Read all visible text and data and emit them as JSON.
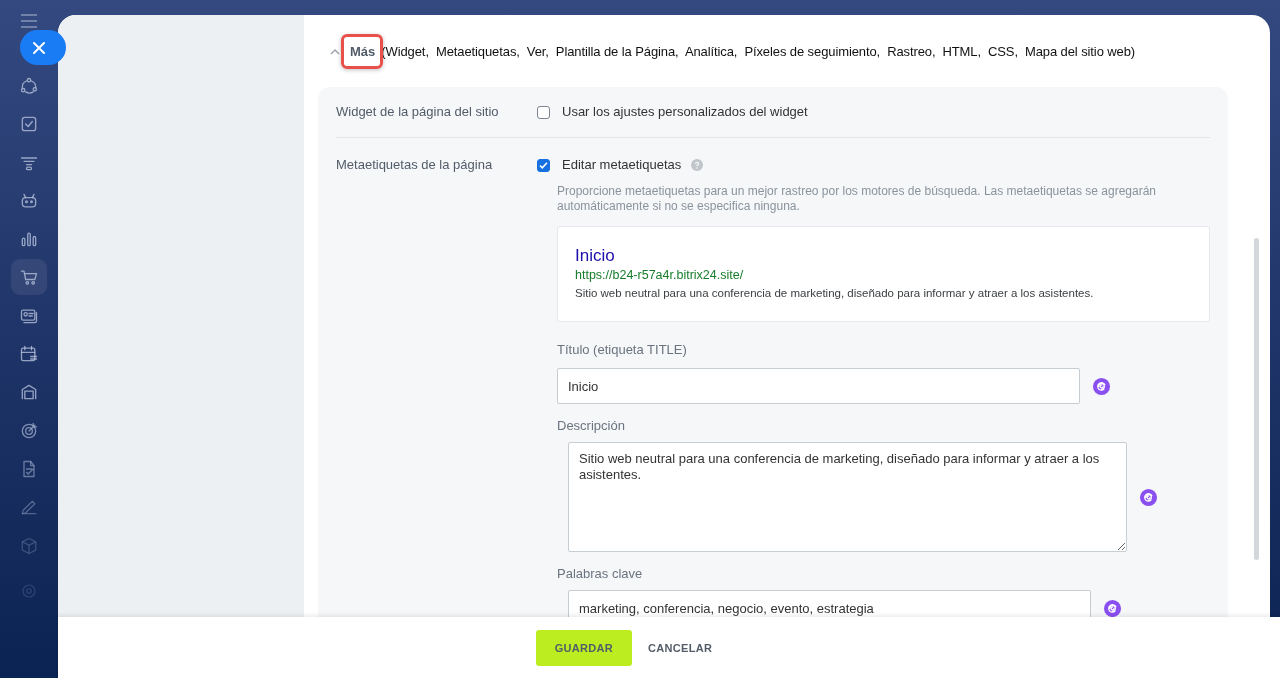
{
  "sidebar": {
    "items": [
      {
        "selected": false
      },
      {
        "selected": false
      },
      {
        "selected": false
      },
      {
        "selected": false
      },
      {
        "selected": false
      },
      {
        "selected": true
      },
      {
        "selected": false
      },
      {
        "selected": false
      },
      {
        "selected": false
      },
      {
        "selected": false
      },
      {
        "selected": false
      },
      {
        "selected": false
      },
      {
        "selected": false
      }
    ]
  },
  "more_section": {
    "expanded": true,
    "label": "Más",
    "highlighted": true,
    "summary": "(Widget,  Metaetiquetas,  Ver,  Plantilla de la Página,  Analítica,  Píxeles de seguimiento,  Rastreo,  HTML,  CSS,  Mapa del sitio web)"
  },
  "settings": [
    {
      "label": "Widget de la página del sitio",
      "option": "Usar los ajustes personalizados del widget",
      "checked": false
    },
    {
      "label": "Metaetiquetas de la página",
      "option": "Editar metaetiquetas",
      "checked": true,
      "hint": "Proporcione metaetiquetas para un mejor rastreo por los motores de búsqueda. Las metaetiquetas se agregarán automáticamente si no se especifica ninguna.",
      "preview": {
        "title": "Inicio",
        "url": "https://b24-r57a4r.bitrix24.site/",
        "description": "Sitio web neutral para una conferencia de marketing, diseñado para informar y atraer a los asistentes."
      },
      "fields": [
        {
          "kind": "input",
          "label": "Título (etiqueta TITLE)",
          "value": "Inicio"
        },
        {
          "kind": "textarea",
          "label": "Descripción",
          "value": "Sitio web neutral para una conferencia de marketing, diseñado para informar y atraer a los asistentes."
        },
        {
          "kind": "input",
          "label": "Palabras clave",
          "value": "marketing, conferencia, negocio, evento, estrategia"
        }
      ]
    }
  ],
  "buttons": [
    {
      "label": "GUARDAR",
      "kind": "primary"
    },
    {
      "label": "CANCELAR",
      "kind": "link"
    }
  ]
}
